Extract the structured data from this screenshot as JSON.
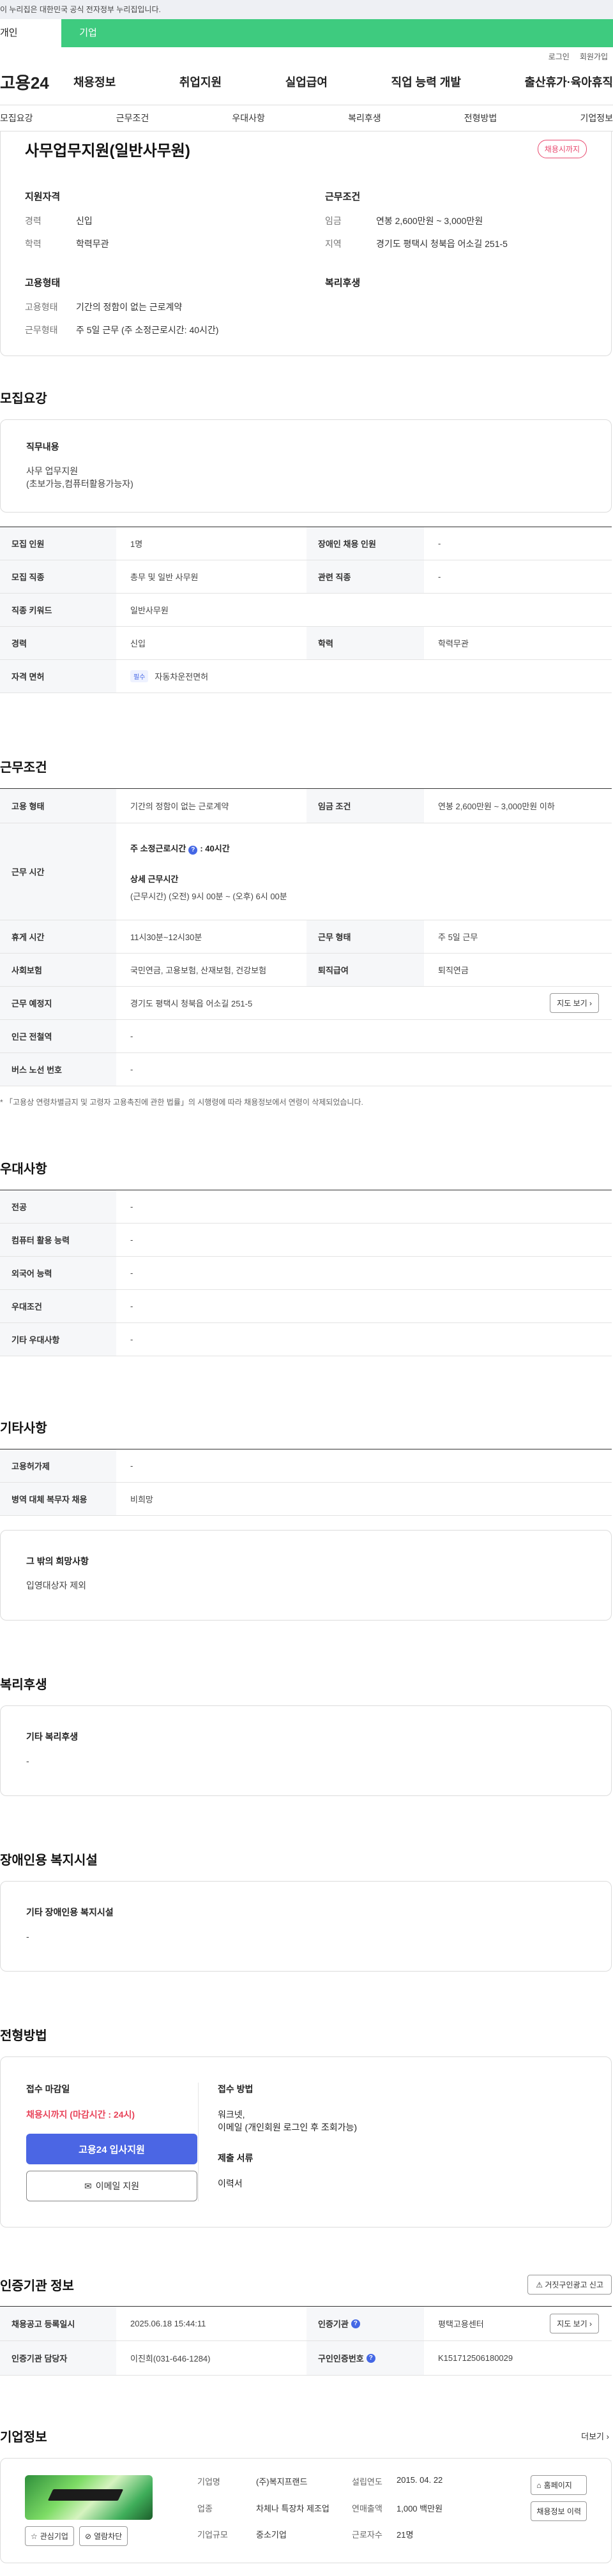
{
  "gov_banner": "이 누리집은 대한민국 공식 전자정부 누리집입니다.",
  "tabs": [
    "개인",
    "기업"
  ],
  "util": [
    "로그인",
    "회원가입"
  ],
  "logo": "고용24",
  "gnb": [
    "채용정보",
    "취업지원",
    "실업급여",
    "직업 능력 개발",
    "출산휴가·육아휴직"
  ],
  "subnav": [
    "모집요강",
    "근무조건",
    "우대사항",
    "복리후생",
    "전형방법",
    "기업정보"
  ],
  "summary": {
    "title": "사무업무지원(일반사무원)",
    "badge": "채용시까지",
    "qual_title": "지원자격",
    "qual": [
      {
        "k": "경력",
        "v": "신입"
      },
      {
        "k": "학력",
        "v": "학력무관"
      }
    ],
    "cond_title": "근무조건",
    "cond": [
      {
        "k": "임금",
        "v": "연봉 2,600만원 ~ 3,000만원"
      },
      {
        "k": "지역",
        "v": "경기도 평택시 청북읍 어소길 251-5"
      }
    ],
    "emp_title": "고용형태",
    "emp": [
      {
        "k": "고용형태",
        "v": "기간의 정함이 없는 근로계약"
      },
      {
        "k": "근무형태",
        "v": "주 5일 근무 (주 소정근로시간: 40시간)"
      }
    ],
    "welfare_title": "복리후생"
  },
  "recruit": {
    "section": "모집요강",
    "duty_title": "직무내용",
    "duty_l1": "사무 업무지원",
    "duty_l2": "(초보가능,컴퓨터활용가능자)",
    "rows": {
      "count_k": "모집 인원",
      "count_v": "1명",
      "dis_k": "장애인 채용 인원",
      "dis_v": "-",
      "job_k": "모집 직종",
      "job_v": "총무 및 일반 사무원",
      "rel_k": "관련 직종",
      "rel_v": "-",
      "kw_k": "직종 키워드",
      "kw_v": "일반사무원",
      "career_k": "경력",
      "career_v": "신입",
      "edu_k": "학력",
      "edu_v": "학력무관",
      "lic_k": "자격 면허",
      "lic_tag": "필수",
      "lic_v": "자동차운전면허"
    }
  },
  "work": {
    "section": "근무조건",
    "type_k": "고용 형태",
    "type_v": "기간의 정함이 없는 근로계약",
    "wage_k": "임금 조건",
    "wage_v": "연봉 2,600만원 ~ 3,000만원 이하",
    "time_k": "근무 시간",
    "time_a1": "주 소정근로시간",
    "time_a2": ": 40시간",
    "time_b": "상세 근무시간",
    "time_c": "(근무시간) (오전) 9시 00분 ~ (오후) 6시 00분",
    "rest_k": "휴게 시간",
    "rest_v": "11시30분~12시30분",
    "wtype_k": "근무 형태",
    "wtype_v": "주 5일 근무",
    "ins_k": "사회보험",
    "ins_v": "국민연금, 고용보험, 산재보험, 건강보험",
    "ret_k": "퇴직급여",
    "ret_v": "퇴직연금",
    "loc_k": "근무 예정지",
    "loc_v": "경기도 평택시 청북읍 어소길 251-5",
    "map_btn": "지도 보기",
    "sub_k": "인근 전철역",
    "sub_v": "-",
    "bus_k": "버스 노선 번호",
    "bus_v": "-",
    "note": "* 「고용상 연령차별금지 및 고령자 고용촉진에 관한 법률」의 시행령에 따라 채용정보에서 연령이 삭제되었습니다."
  },
  "pref": {
    "section": "우대사항",
    "rows": [
      {
        "k": "전공",
        "v": "-"
      },
      {
        "k": "컴퓨터 활용 능력",
        "v": "-"
      },
      {
        "k": "외국어 능력",
        "v": "-"
      },
      {
        "k": "우대조건",
        "v": "-"
      },
      {
        "k": "기타 우대사항",
        "v": "-"
      }
    ]
  },
  "etc": {
    "section": "기타사항",
    "rows": [
      {
        "k": "고용허가제",
        "v": "-"
      },
      {
        "k": "병역 대체 복무자 채용",
        "v": "비희망"
      }
    ],
    "hope_title": "그 밖의 희망사항",
    "hope_v": "입영대상자 제외"
  },
  "welfare": {
    "section": "복리후생",
    "title": "기타 복리후생",
    "v": "-"
  },
  "disab": {
    "section": "장애인용 복지시설",
    "title": "기타 장애인용 복지시설",
    "v": "-"
  },
  "process": {
    "section": "전형방법",
    "deadline_title": "접수 마감일",
    "deadline": "채용시까지 (마감시간 : 24시)",
    "apply_btn": "고용24 입사지원",
    "email_btn": "이메일 지원",
    "method_title": "접수 방법",
    "method_l1": "워크넷,",
    "method_l2": "이메일 (개인회원 로그인 후 조회가능)",
    "docs_title": "제출 서류",
    "docs_v": "이력서"
  },
  "cert": {
    "section": "인증기관 정보",
    "report_btn": "거짓구인광고 신고",
    "reg_k": "채용공고 등록일시",
    "reg_v": "2025.06.18 15:44:11",
    "org_k": "인증기관",
    "org_v": "평택고용센터",
    "map_btn": "지도 보기",
    "mgr_k": "인증기관 담당자",
    "mgr_v": "이진희(031-646-1284)",
    "no_k": "구인인증번호",
    "no_v": "K151712506180029"
  },
  "corp": {
    "section": "기업정보",
    "more": "더보기",
    "fav_btn": "관심기업",
    "block_btn": "열람차단",
    "name_k": "기업명",
    "name_v": "(주)복지프랜드",
    "year_k": "설립연도",
    "year_v": "2015. 04. 22",
    "home_btn": "홈페이지",
    "biz_k": "업종",
    "biz_v": "차체나 특장차 제조업",
    "sales_k": "연매출액",
    "sales_v": "1,000 백만원",
    "hist_btn": "채용정보 이력",
    "staff_k": "근로자수",
    "staff_v": "21명",
    "scale_k": "기업규모",
    "scale_v": "중소기업"
  }
}
